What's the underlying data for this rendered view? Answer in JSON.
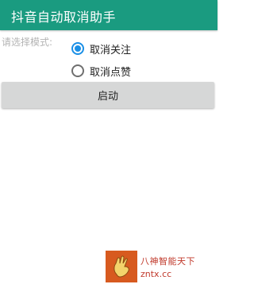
{
  "toolbar": {
    "title": "抖音自动取消助手",
    "color": "#1a9b80"
  },
  "form": {
    "prompt": "请选择模式:",
    "options": [
      {
        "label": "取消关注",
        "checked": true
      },
      {
        "label": "取消点赞",
        "checked": false
      }
    ],
    "accent_color": "#1a8fe6"
  },
  "start_button": {
    "label": "启动"
  },
  "watermark": {
    "line1": "八神智能天下",
    "line2": "zntx.cc"
  }
}
